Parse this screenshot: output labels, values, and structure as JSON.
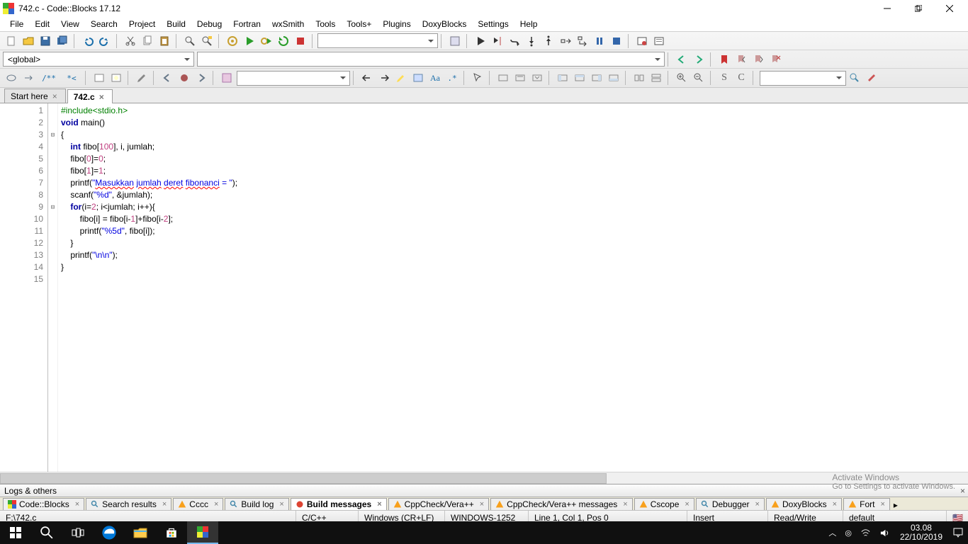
{
  "titlebar": {
    "title": "742.c - Code::Blocks 17.12"
  },
  "menu": [
    "File",
    "Edit",
    "View",
    "Search",
    "Project",
    "Build",
    "Debug",
    "Fortran",
    "wxSmith",
    "Tools",
    "Tools+",
    "Plugins",
    "DoxyBlocks",
    "Settings",
    "Help"
  ],
  "scope_combo": "<global>",
  "tabs": [
    {
      "label": "Start here",
      "active": false
    },
    {
      "label": "742.c",
      "active": true
    }
  ],
  "code": {
    "lines": [
      {
        "n": 1,
        "html": "<span class='pp'>#include&lt;stdio.h&gt;</span>"
      },
      {
        "n": 2,
        "html": "<span class='kw'>void</span> main<span>()</span>"
      },
      {
        "n": 3,
        "html": "{",
        "fold": "[-]"
      },
      {
        "n": 4,
        "html": "    <span class='kw'>int</span> fibo[<span class='num'>100</span>], i, jumlah;"
      },
      {
        "n": 5,
        "html": "    fibo[<span class='num'>0</span>]=<span class='num'>0</span>;"
      },
      {
        "n": 6,
        "html": "    fibo[<span class='num'>1</span>]=<span class='num'>1</span>;"
      },
      {
        "n": 7,
        "html": "    printf(<span class='str'>\"<span class='spell'>Masukkan</span> <span class='spell'>jumlah</span> <span class='spell'>deret</span> <span class='spell'>fibonanci</span> = \"</span>);"
      },
      {
        "n": 8,
        "html": "    scanf(<span class='str'>\"%d\"</span>, &amp;jumlah);"
      },
      {
        "n": 9,
        "html": "    <span class='kw'>for</span>(i=<span class='num'>2</span>; i&lt;jumlah; i++){",
        "fold": "[-]"
      },
      {
        "n": 10,
        "html": "        fibo[i] = fibo[i-<span class='num'>1</span>]+fibo[i-<span class='num'>2</span>];"
      },
      {
        "n": 11,
        "html": "        printf(<span class='str'>\"%5d\"</span>, fibo[i]);"
      },
      {
        "n": 12,
        "html": "    }"
      },
      {
        "n": 13,
        "html": "    printf(<span class='str'>\"\\n\\n\"</span>);"
      },
      {
        "n": 14,
        "html": "}"
      },
      {
        "n": 15,
        "html": ""
      }
    ]
  },
  "logs_header": "Logs & others",
  "logs_tabs": [
    {
      "label": "Code::Blocks",
      "icon": "cb"
    },
    {
      "label": "Search results",
      "icon": "search"
    },
    {
      "label": "Cccc",
      "icon": "orange"
    },
    {
      "label": "Build log",
      "icon": "search"
    },
    {
      "label": "Build messages",
      "icon": "red",
      "active": true
    },
    {
      "label": "CppCheck/Vera++",
      "icon": "orange"
    },
    {
      "label": "CppCheck/Vera++ messages",
      "icon": "orange"
    },
    {
      "label": "Cscope",
      "icon": "orange"
    },
    {
      "label": "Debugger",
      "icon": "search"
    },
    {
      "label": "DoxyBlocks",
      "icon": "orange"
    },
    {
      "label": "Fort",
      "icon": "orange"
    }
  ],
  "status": {
    "path": "F:\\742.c",
    "lang": "C/C++",
    "eol": "Windows (CR+LF)",
    "encoding": "WINDOWS-1252",
    "pos": "Line 1, Col 1, Pos 0",
    "ins": "Insert",
    "rw": "Read/Write",
    "profile": "default"
  },
  "watermark": {
    "l1": "Activate Windows",
    "l2": "Go to Settings to activate Windows."
  },
  "tray": {
    "time": "03.08",
    "date": "22/10/2019"
  }
}
